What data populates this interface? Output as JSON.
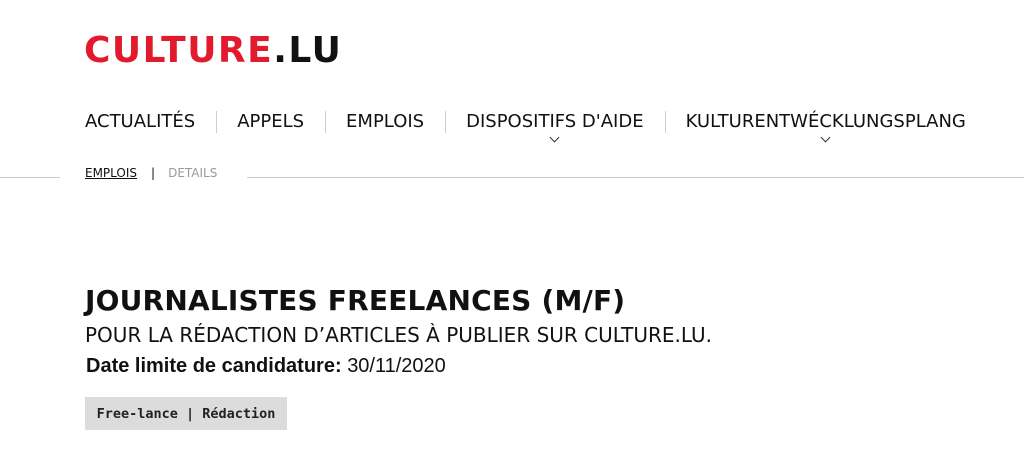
{
  "logo": {
    "brand": "CULTURE",
    "dot": ".",
    "tld": "LU"
  },
  "nav": {
    "items": [
      {
        "label": "ACTUALITÉS"
      },
      {
        "label": "APPELS"
      },
      {
        "label": "EMPLOIS"
      },
      {
        "label": "DISPOSITIFS D'AIDE"
      },
      {
        "label": "KULTURENTWÉCKLUNGSPLANG"
      }
    ]
  },
  "breadcrumb": {
    "link": "EMPLOIS",
    "separator": "|",
    "current": "DETAILS"
  },
  "job": {
    "title": "JOURNALISTES FREELANCES (M/F)",
    "subtitle": "POUR LA RÉDACTION D’ARTICLES À PUBLIER SUR CULTURE.LU.",
    "deadline_label": "Date limite de candidature:",
    "deadline_value": "30/11/2020",
    "tags": "Free-lance | Rédaction"
  },
  "colors": {
    "brand_red": "#e3192d",
    "tag_bg": "#dcdcdc",
    "muted": "#9a9a9a"
  }
}
